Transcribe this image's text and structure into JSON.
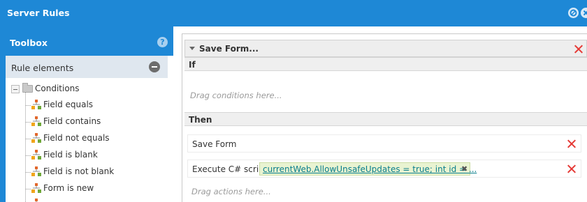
{
  "window": {
    "title": "Server Rules"
  },
  "toolbox": {
    "title": "Toolbox",
    "help_glyph": "?",
    "section_title": "Rule elements",
    "tree": {
      "group_label": "Conditions",
      "items": [
        {
          "label": "Field equals"
        },
        {
          "label": "Field contains"
        },
        {
          "label": "Field not equals"
        },
        {
          "label": "Field is blank"
        },
        {
          "label": "Field is not blank"
        },
        {
          "label": "Form is new"
        }
      ]
    }
  },
  "rule": {
    "name": "Save Form...",
    "if_label": "If",
    "conditions_placeholder": "Drag conditions here...",
    "then_label": "Then",
    "actions": [
      {
        "label": "Save Form"
      },
      {
        "label": "Execute C# script",
        "script_preview": "currentWeb.AllowUnsafeUpdates = true; int id = ...",
        "remove_glyph": "✖"
      }
    ],
    "actions_placeholder": "Drag actions here..."
  },
  "colors": {
    "header_blue": "#1e88d6",
    "delete_red": "#e53935",
    "script_chip_bg": "#e9f3d1"
  }
}
